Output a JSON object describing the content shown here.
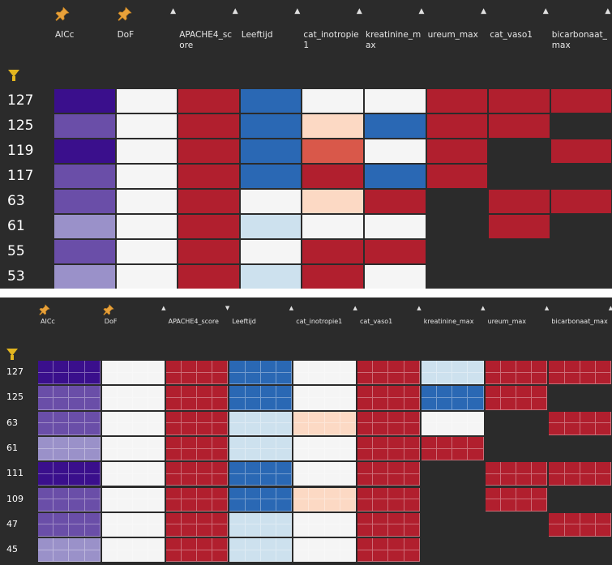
{
  "colors": {
    "dark": "#2b2b2b",
    "purple_dark": "#3a0f8c",
    "purple_mid": "#6a4ea8",
    "purple_light": "#9a91c9",
    "white": "#f5f5f5",
    "red": "#b11f2e",
    "blue": "#2a68b4",
    "blue_light": "#cde1ee",
    "peach": "#fcd9c4",
    "salmon": "#d9584a",
    "filter_yellow": "#e2b51f"
  },
  "top_panel": {
    "columns": [
      {
        "label": "AICc",
        "pinned": true,
        "sort": "none"
      },
      {
        "label": "DoF",
        "pinned": true,
        "sort": "asc"
      },
      {
        "label": "APACHE4_sc\nore",
        "pinned": false,
        "sort": "asc"
      },
      {
        "label": "Leeftijd",
        "pinned": false,
        "sort": "asc"
      },
      {
        "label": "cat_inotropie\n1",
        "pinned": false,
        "sort": "asc"
      },
      {
        "label": "kreatinine_m\nax",
        "pinned": false,
        "sort": "asc"
      },
      {
        "label": "ureum_max",
        "pinned": false,
        "sort": "asc"
      },
      {
        "label": "cat_vaso1",
        "pinned": false,
        "sort": "asc"
      },
      {
        "label": "bicarbonaat_\nmax",
        "pinned": false,
        "sort": "asc"
      }
    ],
    "rows": [
      {
        "label": "127",
        "cells": [
          "purple_dark",
          "white",
          "red",
          "blue",
          "white",
          "white",
          "red",
          "red",
          "red"
        ]
      },
      {
        "label": "125",
        "cells": [
          "purple_mid",
          "white",
          "red",
          "blue",
          "peach",
          "blue",
          "red",
          "red",
          "dark"
        ]
      },
      {
        "label": "119",
        "cells": [
          "purple_dark",
          "white",
          "red",
          "blue",
          "salmon",
          "white",
          "red",
          "dark",
          "red"
        ]
      },
      {
        "label": "117",
        "cells": [
          "purple_mid",
          "white",
          "red",
          "blue",
          "red",
          "blue",
          "red",
          "dark",
          "dark"
        ]
      },
      {
        "label": "63",
        "cells": [
          "purple_mid",
          "white",
          "red",
          "white",
          "peach",
          "red",
          "dark",
          "red",
          "red"
        ]
      },
      {
        "label": "61",
        "cells": [
          "purple_light",
          "white",
          "red",
          "blue_light",
          "white",
          "white",
          "dark",
          "red",
          "dark"
        ]
      },
      {
        "label": "55",
        "cells": [
          "purple_mid",
          "white",
          "red",
          "white",
          "red",
          "red",
          "dark",
          "dark",
          "dark"
        ]
      },
      {
        "label": "53",
        "cells": [
          "purple_light",
          "white",
          "red",
          "blue_light",
          "red",
          "white",
          "dark",
          "dark",
          "dark"
        ]
      }
    ]
  },
  "bottom_panel": {
    "columns": [
      {
        "label": "AICc",
        "pinned": true,
        "sort": "none"
      },
      {
        "label": "DoF",
        "pinned": true,
        "sort": "asc"
      },
      {
        "label": "APACHE4_score",
        "pinned": false,
        "sort": "desc"
      },
      {
        "label": "Leeftijd",
        "pinned": false,
        "sort": "asc"
      },
      {
        "label": "cat_inotropie1",
        "pinned": false,
        "sort": "asc"
      },
      {
        "label": "cat_vaso1",
        "pinned": false,
        "sort": "asc"
      },
      {
        "label": "kreatinine_max",
        "pinned": false,
        "sort": "asc"
      },
      {
        "label": "ureum_max",
        "pinned": false,
        "sort": "asc"
      },
      {
        "label": "bicarbonaat_max",
        "pinned": false,
        "sort": "asc"
      }
    ],
    "rows": [
      {
        "label": "127",
        "cells": [
          "purple_dark",
          "white",
          "red",
          "blue",
          "white",
          "red",
          "blue_light",
          "red",
          "red"
        ]
      },
      {
        "label": "125",
        "cells": [
          "purple_mid",
          "white",
          "red",
          "blue",
          "white",
          "red",
          "blue",
          "red",
          "dark"
        ]
      },
      {
        "label": "63",
        "cells": [
          "purple_mid",
          "white",
          "red",
          "blue_light",
          "peach",
          "red",
          "white",
          "dark",
          "red"
        ]
      },
      {
        "label": "61",
        "cells": [
          "purple_light",
          "white",
          "red",
          "blue_light",
          "white",
          "red",
          "red",
          "dark",
          "dark"
        ]
      },
      {
        "label": "111",
        "cells": [
          "purple_dark",
          "white",
          "red",
          "blue",
          "white",
          "red",
          "dark",
          "red",
          "red"
        ]
      },
      {
        "label": "109",
        "cells": [
          "purple_mid",
          "white",
          "red",
          "blue",
          "peach",
          "red",
          "dark",
          "red",
          "dark"
        ]
      },
      {
        "label": "47",
        "cells": [
          "purple_mid",
          "white",
          "red",
          "blue_light",
          "white",
          "red",
          "dark",
          "dark",
          "red"
        ]
      },
      {
        "label": "45",
        "cells": [
          "purple_light",
          "white",
          "red",
          "blue_light",
          "white",
          "red",
          "dark",
          "dark",
          "dark"
        ]
      }
    ]
  }
}
